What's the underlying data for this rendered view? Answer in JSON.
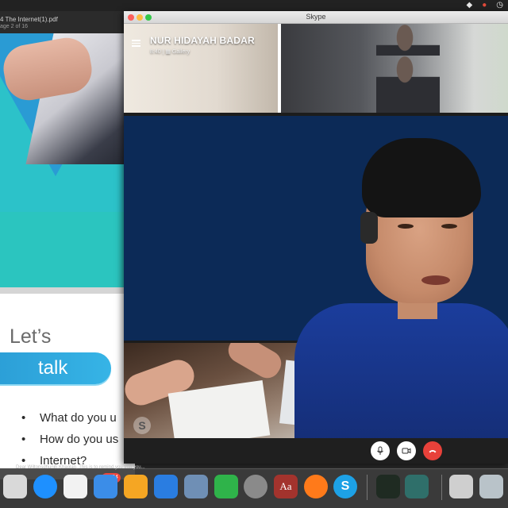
{
  "pdf_viewer": {
    "title": "4 The Internet(1).pdf",
    "subtitle": "age 2 of 16",
    "slide2": {
      "heading": "Let’s",
      "pill_text": "talk",
      "bullets": [
        "What do you u",
        "How do you us",
        "Internet?"
      ]
    },
    "footer_snippet": "Dear Wiltonsdhunih Khaolan, This is to remind you that you..."
  },
  "skype": {
    "window_title": "Skype",
    "contact_name": "NUR HIDAYAH BADAR",
    "call_duration": "8:40",
    "view_mode": "Gallery",
    "watermark": "S",
    "controls": {
      "mic_icon": "microphone-icon",
      "camera_icon": "video-camera-icon",
      "end_call_icon": "end-call-icon",
      "end_call_color": "#e8413a"
    },
    "main_video_bg": "#0c2a57"
  },
  "dock": {
    "mail_badge": "3,054",
    "apps": [
      {
        "name": "launchpad-icon",
        "color": "#d9d9d9"
      },
      {
        "name": "safari-icon",
        "color": "#1e90ff"
      },
      {
        "name": "textedit-icon",
        "color": "#f2f2f2"
      },
      {
        "name": "mail-icon",
        "color": "#3b8de8"
      },
      {
        "name": "pages-icon",
        "color": "#f5a623"
      },
      {
        "name": "keynote-icon",
        "color": "#2a7de1"
      },
      {
        "name": "preview-icon",
        "color": "#6f8fb5"
      },
      {
        "name": "numbers-icon",
        "color": "#2fb34a"
      },
      {
        "name": "system-preferences-icon",
        "color": "#8a8a8a"
      },
      {
        "name": "dictionary-icon",
        "color": "#a3332d"
      },
      {
        "name": "firefox-icon",
        "color": "#ff7a1a"
      },
      {
        "name": "skype-icon",
        "color": "#1da1e6"
      },
      {
        "name": "activity-monitor-icon",
        "color": "#1f2b22"
      },
      {
        "name": "zoom-app-icon",
        "color": "#2f6f6a"
      },
      {
        "name": "document-thumbnail-icon",
        "color": "#cfcfcf"
      },
      {
        "name": "presentation-thumbnail-icon",
        "color": "#b9c3c9"
      }
    ],
    "dictionary_label": "Aa"
  }
}
